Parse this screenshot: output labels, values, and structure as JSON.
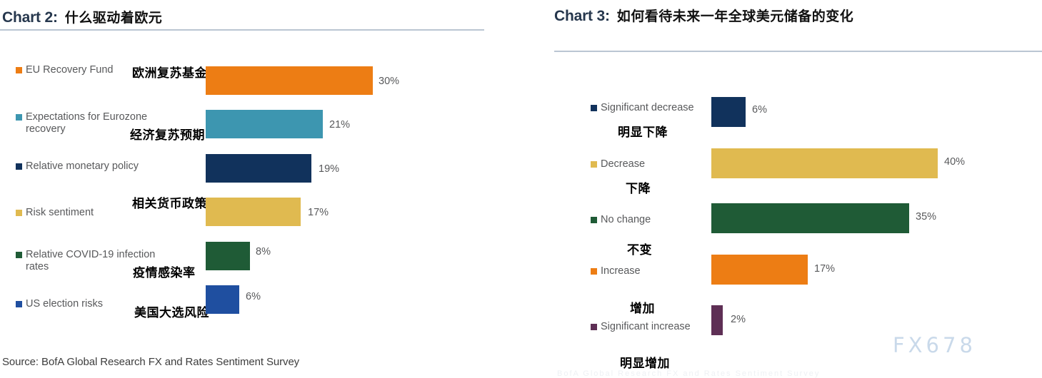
{
  "watermark": "FX678",
  "faint_bottom_text": "BofA Global Research FX and Rates Sentiment Survey",
  "chart2": {
    "label": "Chart 2:",
    "title_cn": "什么驱动着欧元",
    "source": "Source: BofA Global Research FX and Rates Sentiment Survey",
    "chart_data": {
      "type": "bar",
      "orientation": "horizontal",
      "title": "Chart 2: 什么驱动着欧元",
      "xlabel": "",
      "ylabel": "",
      "grid": false,
      "legend_position": "left",
      "xlim": [
        0,
        30
      ],
      "categories": [
        "EU Recovery Fund",
        "Expectations for Eurozone\nrecovery",
        "Relative monetary policy",
        "Risk sentiment",
        "Relative COVID-19 infection\nrates",
        "US election risks"
      ],
      "categories_cn": [
        "欧洲复苏基金",
        "经济复苏预期",
        "相关货币政策",
        "疫情感染率",
        "美国大选风险"
      ],
      "values": [
        30,
        21,
        19,
        17,
        8,
        6
      ],
      "value_labels": [
        "30%",
        "21%",
        "19%",
        "17%",
        "8%",
        "6%"
      ],
      "colors": [
        "#ED7D14",
        "#3D96B0",
        "#11325C",
        "#E0BA50",
        "#1F5B36",
        "#1F4FA0"
      ]
    },
    "bars": [
      {
        "label": "EU Recovery Fund",
        "label_cn": "欧洲复苏基金",
        "value": 30,
        "value_label": "30%",
        "color": "#ED7D14"
      },
      {
        "label": "Expectations for Eurozone\nrecovery",
        "label_cn": "经济复苏预期",
        "value": 21,
        "value_label": "21%",
        "color": "#3D96B0"
      },
      {
        "label": "Relative monetary policy",
        "label_cn": "相关货币政策",
        "value": 19,
        "value_label": "19%",
        "color": "#11325C"
      },
      {
        "label": "Risk sentiment",
        "label_cn": "疫情感染率",
        "value": 17,
        "value_label": "17%",
        "color": "#E0BA50"
      },
      {
        "label": "Relative COVID-19 infection\nrates",
        "label_cn": "美国大选风险",
        "value": 8,
        "value_label": "8%",
        "color": "#1F5B36"
      },
      {
        "label": "US election risks",
        "label_cn": "",
        "value": 6,
        "value_label": "6%",
        "color": "#1F4FA0"
      }
    ],
    "cn_notes": [
      "欧洲复苏基金",
      "经济复苏预期",
      "相关货币政策",
      "疫情感染率",
      "美国大选风险"
    ]
  },
  "chart3": {
    "label": "Chart 3:",
    "title_cn": "如何看待未来一年全球美元储备的变化",
    "chart_data": {
      "type": "bar",
      "orientation": "horizontal",
      "title": "Chart 3: 如何看待未来一年全球美元储备的变化",
      "xlabel": "",
      "ylabel": "",
      "grid": false,
      "legend_position": "left",
      "xlim": [
        0,
        40
      ],
      "categories": [
        "Significant decrease",
        "Decrease",
        "No change",
        "Increase",
        "Significant increase"
      ],
      "categories_cn": [
        "明显下降",
        "下降",
        "不变",
        "增加",
        "明显增加"
      ],
      "values": [
        6,
        40,
        35,
        17,
        2
      ],
      "value_labels": [
        "6%",
        "40%",
        "35%",
        "17%",
        "2%"
      ],
      "colors": [
        "#11325C",
        "#E0BA50",
        "#1F5B36",
        "#ED7D14",
        "#5E2F55"
      ]
    },
    "bars": [
      {
        "label": "Significant decrease",
        "label_cn": "明显下降",
        "value": 6,
        "value_label": "6%",
        "color": "#11325C"
      },
      {
        "label": "Decrease",
        "label_cn": "下降",
        "value": 40,
        "value_label": "40%",
        "color": "#E0BA50"
      },
      {
        "label": "No change",
        "label_cn": "不变",
        "value": 35,
        "value_label": "35%",
        "color": "#1F5B36"
      },
      {
        "label": "Increase",
        "label_cn": "增加",
        "value": 17,
        "value_label": "17%",
        "color": "#ED7D14"
      },
      {
        "label": "Significant increase",
        "label_cn": "明显增加",
        "value": 2,
        "value_label": "2%",
        "color": "#5E2F55"
      }
    ]
  }
}
